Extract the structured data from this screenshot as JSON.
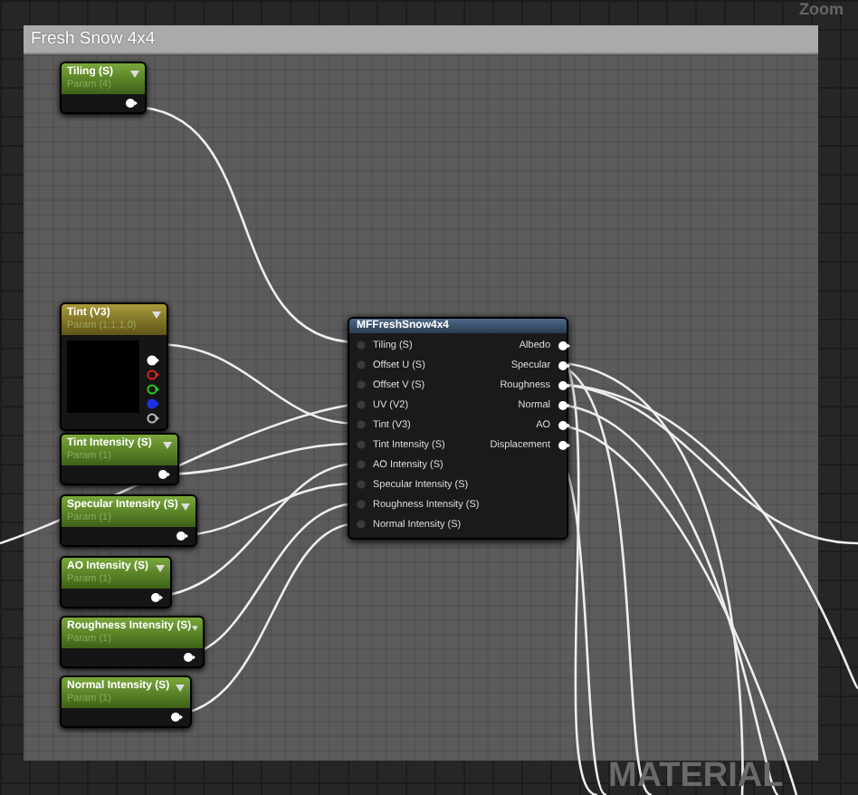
{
  "editor": {
    "zoom_label": "Zoom",
    "watermark": "MATERIAL"
  },
  "comment": {
    "title": "Fresh Snow 4x4"
  },
  "param_nodes": [
    {
      "kind": "scalar",
      "title": "Tiling (S)",
      "subtitle": "Param (4)"
    },
    {
      "kind": "vector",
      "title": "Tint (V3)",
      "subtitle": "Param (1,1,1,0)"
    },
    {
      "kind": "scalar",
      "title": "Tint Intensity (S)",
      "subtitle": "Param (1)"
    },
    {
      "kind": "scalar",
      "title": "Specular Intensity (S)",
      "subtitle": "Param (1)"
    },
    {
      "kind": "scalar",
      "title": "AO Intensity (S)",
      "subtitle": "Param (1)"
    },
    {
      "kind": "scalar",
      "title": "Roughness Intensity (S)",
      "subtitle": "Param (1)"
    },
    {
      "kind": "scalar",
      "title": "Normal Intensity (S)",
      "subtitle": "Param (1)"
    }
  ],
  "function_node": {
    "title": "MFFreshSnow4x4",
    "inputs": [
      "Tiling (S)",
      "Offset U (S)",
      "Offset V (S)",
      "UV (V2)",
      "Tint (V3)",
      "Tint Intensity (S)",
      "AO Intensity (S)",
      "Specular Intensity (S)",
      "Roughness Intensity (S)",
      "Normal Intensity (S)"
    ],
    "outputs": [
      "Albedo",
      "Specular",
      "Roughness",
      "Normal",
      "AO",
      "Displacement"
    ]
  }
}
